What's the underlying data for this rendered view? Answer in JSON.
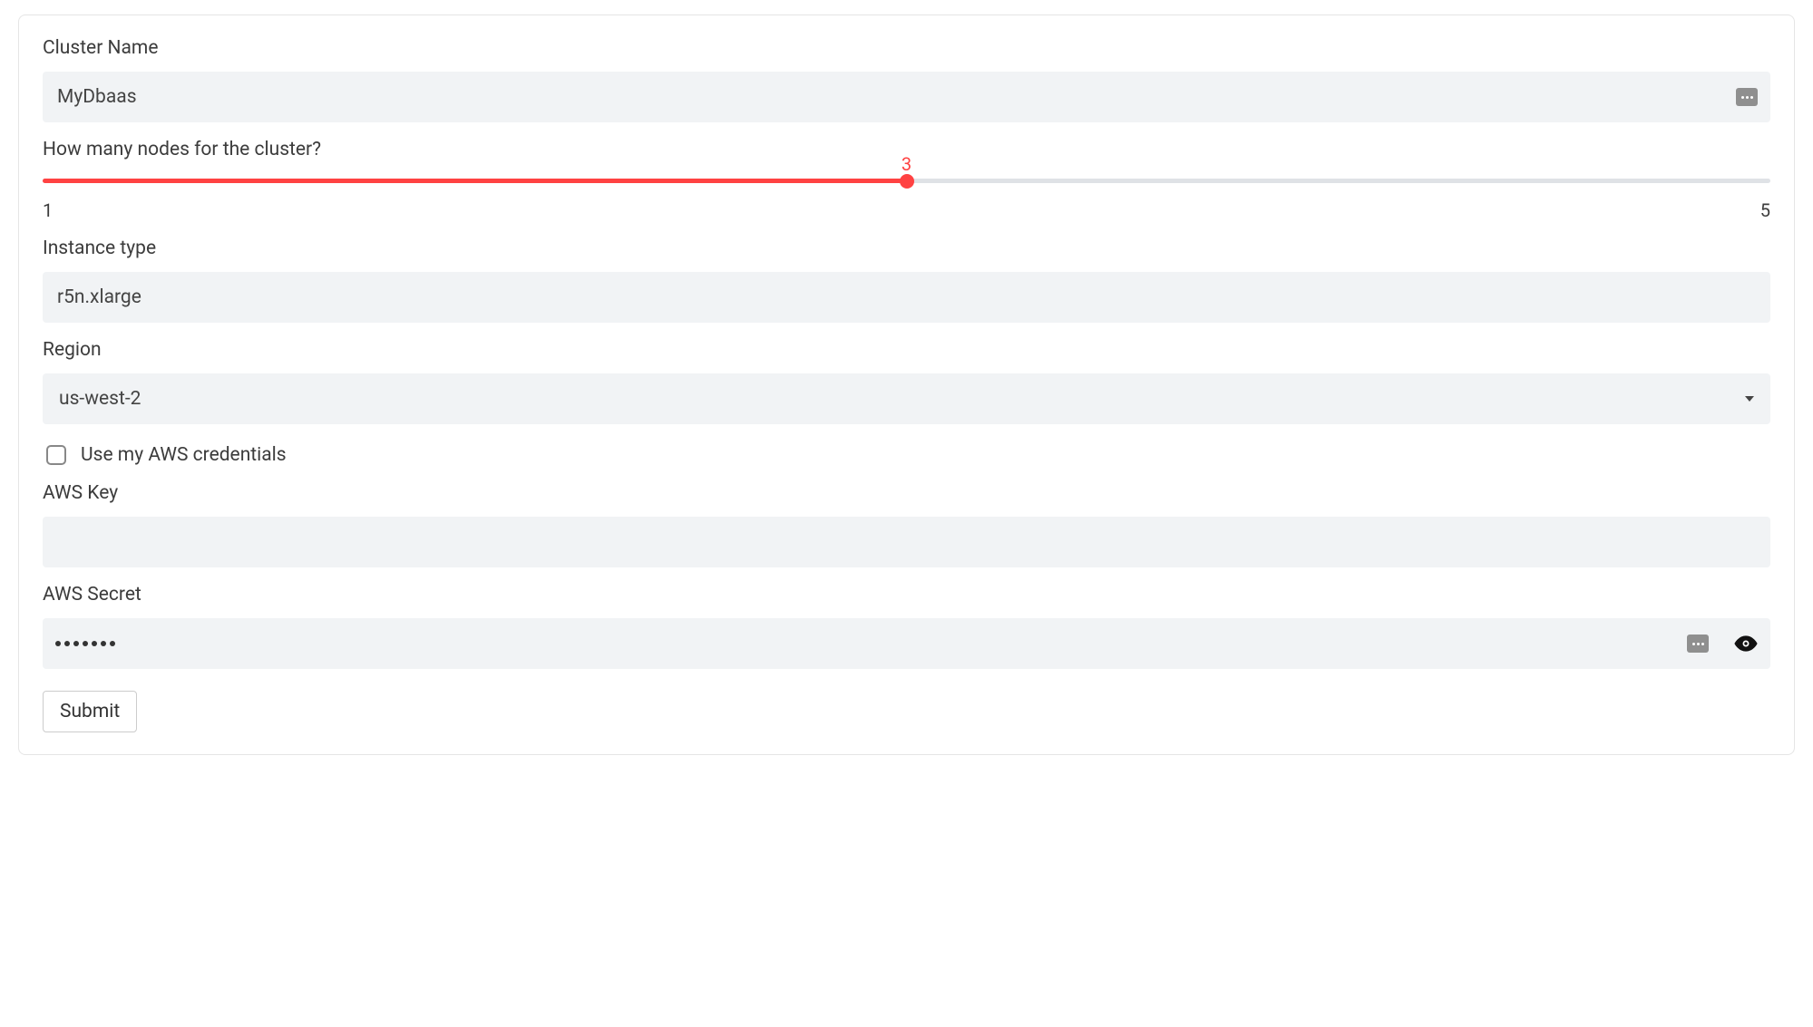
{
  "form": {
    "cluster_name": {
      "label": "Cluster Name",
      "value": "MyDbaas"
    },
    "nodes": {
      "label": "How many nodes for the cluster?",
      "min": 1,
      "max": 5,
      "value": 3
    },
    "instance_type": {
      "label": "Instance type",
      "value": "r5n.xlarge"
    },
    "region": {
      "label": "Region",
      "value": "us-west-2"
    },
    "use_aws_creds": {
      "label": "Use my AWS credentials",
      "checked": false
    },
    "aws_key": {
      "label": "AWS Key",
      "value": ""
    },
    "aws_secret": {
      "label": "AWS Secret",
      "masked_length": 7
    },
    "submit_label": "Submit"
  },
  "colors": {
    "accent": "#ff4242",
    "input_bg": "#f1f3f5"
  }
}
